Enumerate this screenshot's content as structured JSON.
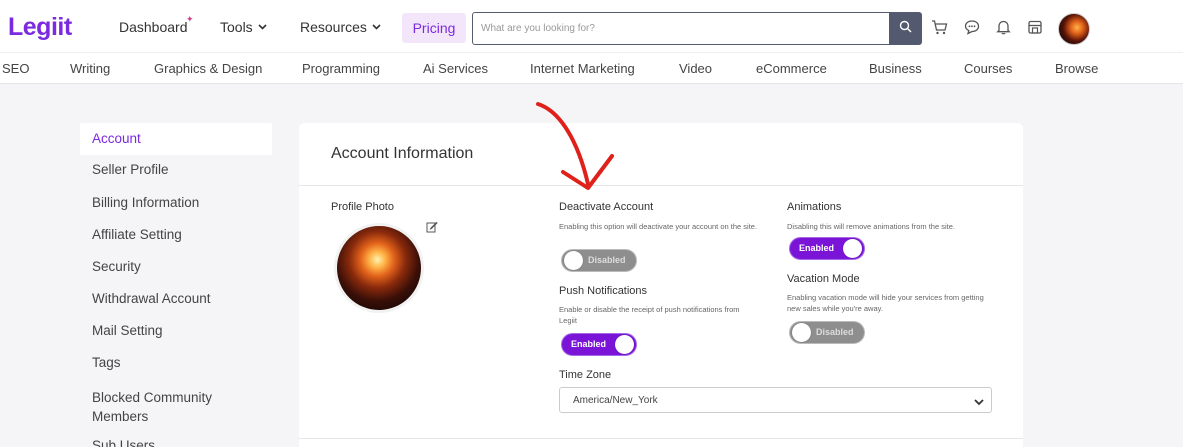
{
  "header": {
    "logo": "Legiit",
    "nav": {
      "dashboard": "Dashboard",
      "tools": "Tools",
      "resources": "Resources",
      "pricing": "Pricing"
    },
    "search": {
      "placeholder": "What are you looking for?"
    }
  },
  "categories": [
    "SEO",
    "Writing",
    "Graphics & Design",
    "Programming",
    "Ai Services",
    "Internet Marketing",
    "Video",
    "eCommerce",
    "Business",
    "Courses",
    "Browse"
  ],
  "sidebar": {
    "items": [
      {
        "label": "Account"
      },
      {
        "label": "Seller Profile"
      },
      {
        "label": "Billing Information"
      },
      {
        "label": "Affiliate Setting"
      },
      {
        "label": "Security"
      },
      {
        "label": "Withdrawal Account"
      },
      {
        "label": "Mail Setting"
      },
      {
        "label": "Tags"
      },
      {
        "label": "Blocked Community Members"
      },
      {
        "label": "Sub Users"
      }
    ]
  },
  "account": {
    "title": "Account Information",
    "profile_photo_label": "Profile Photo",
    "deactivate": {
      "label": "Deactivate Account",
      "desc": "Enabling this option will deactivate your account on the site.",
      "state": "Disabled"
    },
    "push": {
      "label": "Push Notifications",
      "desc": "Enable or disable the receipt of push notifications from Legiit",
      "state": "Enabled"
    },
    "animations": {
      "label": "Animations",
      "desc": "Disabling this will remove animations from the site.",
      "state": "Enabled"
    },
    "vacation": {
      "label": "Vacation Mode",
      "desc": "Enabling vacation mode will hide your services from getting new sales while you're away.",
      "state": "Disabled"
    },
    "timezone": {
      "label": "Time Zone",
      "value": "America/New_York"
    }
  },
  "colors": {
    "brand": "#7b2ae0",
    "toggle_on": "#7a14d6",
    "toggle_off": "#8e8e8e",
    "annotation": "#e0201b"
  }
}
